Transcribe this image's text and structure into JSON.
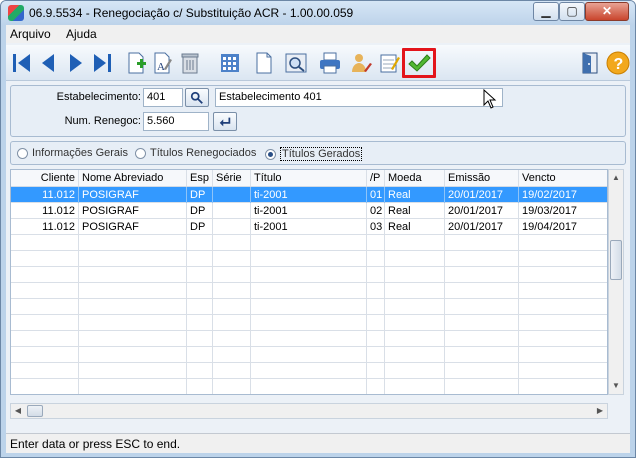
{
  "window": {
    "title": "06.9.5534 - Renegociação c/ Substituição ACR - 1.00.00.059"
  },
  "window_controls": {
    "minimize": "▁",
    "maximize": "▢",
    "close": "✕"
  },
  "menu": [
    {
      "label": "Arquivo"
    },
    {
      "label": "Ajuda"
    }
  ],
  "toolbar": {
    "icons": [
      "first-record-icon",
      "previous-record-icon",
      "next-record-icon",
      "last-record-icon",
      "new-document-icon",
      "edit-document-icon",
      "delete-icon",
      "calendar-grid-icon",
      "blank-document-icon",
      "preview-icon",
      "print-icon",
      "user-edit-icon",
      "notepad-icon",
      "confirm-check-icon",
      "exit-door-icon",
      "help-icon"
    ],
    "highlighted": "confirm-check-icon"
  },
  "form": {
    "estabelecimento_label": "Estabelecimento:",
    "estabelecimento_value": "401",
    "estabelecimento_desc": "Estabelecimento 401",
    "renegoc_label": "Num. Renegoc:",
    "renegoc_value": "5.560"
  },
  "tabs": [
    {
      "label": "Informações Gerais",
      "selected": false
    },
    {
      "label": "Títulos Renegociados",
      "selected": false
    },
    {
      "label": "Títulos Gerados",
      "selected": true
    }
  ],
  "table": {
    "columns": [
      "Cliente",
      "Nome Abreviado",
      "Esp",
      "Série",
      "Título",
      "/P",
      "Moeda",
      "Emissão",
      "Vencto"
    ],
    "rows": [
      [
        "11.012",
        "POSIGRAF",
        "DP",
        "",
        "ti-2001",
        "01",
        "Real",
        "20/01/2017",
        "19/02/2017"
      ],
      [
        "11.012",
        "POSIGRAF",
        "DP",
        "",
        "ti-2001",
        "02",
        "Real",
        "20/01/2017",
        "19/03/2017"
      ],
      [
        "11.012",
        "POSIGRAF",
        "DP",
        "",
        "ti-2001",
        "03",
        "Real",
        "20/01/2017",
        "19/04/2017"
      ]
    ],
    "selected_row": 0
  },
  "status": {
    "text": "Enter data or press ESC to end."
  },
  "colors": {
    "selection": "#3399ff",
    "highlight_border": "#e3141b",
    "window_frame": "#bcd3ea"
  }
}
